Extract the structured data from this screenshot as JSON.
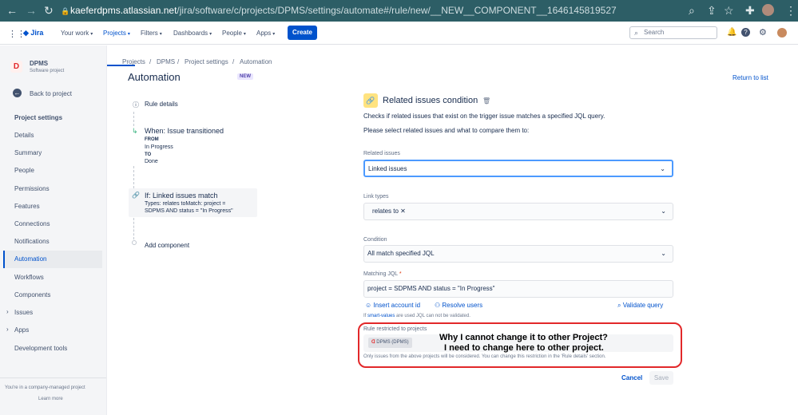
{
  "browser": {
    "url_domain": "kaeferdpms.atlassian.net",
    "url_path": "/jira/software/c/projects/DPMS/settings/automate#/rule/new/__NEW__COMPONENT__1646145819527"
  },
  "topnav": {
    "logo": "Jira",
    "items": [
      "Your work",
      "Projects",
      "Filters",
      "Dashboards",
      "People",
      "Apps"
    ],
    "create": "Create",
    "search_placeholder": "Search"
  },
  "sidebar": {
    "project_name": "DPMS",
    "project_type": "Software project",
    "back": "Back to project",
    "section": "Project settings",
    "items": [
      "Details",
      "Summary",
      "People",
      "Permissions",
      "Features",
      "Connections",
      "Notifications",
      "Automation",
      "Workflows",
      "Components",
      "Issues",
      "Apps",
      "Development tools"
    ],
    "footer": "You're in a company-managed project",
    "learn_more": "Learn more"
  },
  "breadcrumb": [
    "Projects",
    "/",
    "DPMS",
    "/",
    "Project settings",
    "/",
    "Automation"
  ],
  "page": {
    "title": "Automation",
    "badge": "NEW",
    "return": "Return to list"
  },
  "rule": {
    "details": "Rule details",
    "trigger_title": "When: Issue transitioned",
    "from_label": "FROM",
    "from_value": "In Progress",
    "to_label": "TO",
    "to_value": "Done",
    "condition_title": "If: Linked issues match",
    "condition_desc1": "Types: relates toMatch: project =",
    "condition_desc2": "SDPMS AND status = \"In Progress\"",
    "add": "Add component"
  },
  "panel": {
    "title": "Related issues condition",
    "desc1": "Checks if related issues that exist on the trigger issue matches a specified JQL query.",
    "desc2": "Please select related issues and what to compare them to:",
    "related_label": "Related issues",
    "related_value": "Linked issues",
    "link_types_label": "Link types",
    "link_type_tag": "relates to",
    "condition_label": "Condition",
    "condition_value": "All match specified JQL",
    "jql_label": "Matching JQL",
    "required_mark": "*",
    "jql_value": "project = SDPMS AND status = \"In Progress\"",
    "insert_account": "Insert account id",
    "resolve_users": "Resolve users",
    "validate": "Validate query",
    "smart_prefix": "If",
    "smart_link": "smart-values",
    "smart_suffix": "are used JQL can not be validated.",
    "restricted_label": "Rule restricted to projects",
    "project_tag": "DPMS (DPMS)",
    "restricted_note": "Only issues from the above projects will be considered. You can change this restriction in the 'Rule details' section.",
    "cancel": "Cancel",
    "save": "Save"
  },
  "annotation": {
    "line1": "Why I cannot change it to other Project?",
    "line2": "I need to change here to other project."
  },
  "colors": {
    "accent": "#0052cc",
    "chrome": "#2d5e66",
    "annotation": "#e2282a"
  }
}
